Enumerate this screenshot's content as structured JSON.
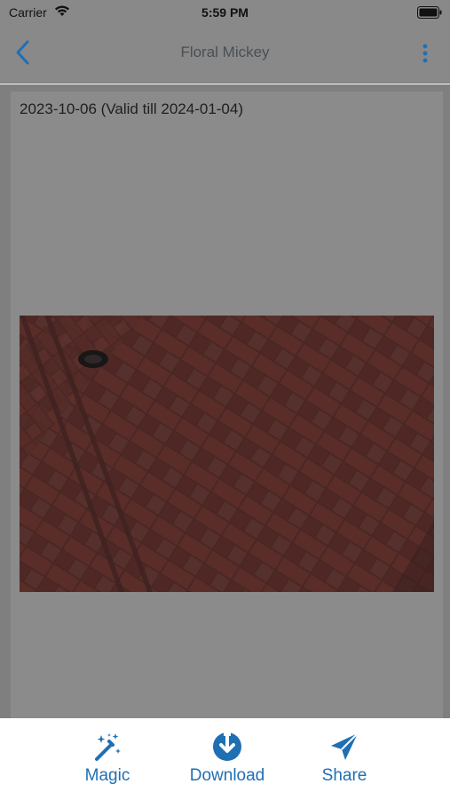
{
  "status_bar": {
    "carrier": "Carrier",
    "time": "5:59 PM"
  },
  "nav": {
    "title": "Floral Mickey",
    "back_icon": "chevron-left-icon",
    "more_icon": "more-vertical-icon"
  },
  "card": {
    "date_text": "2023-10-06 (Valid till 2024-01-04)",
    "photo": "brick-pavement-photo"
  },
  "toolbar": {
    "magic_label": "Magic",
    "download_label": "Download",
    "share_label": "Share"
  },
  "colors": {
    "accent": "#1f6fb3",
    "overlay_dim": "#7f7f7f"
  }
}
